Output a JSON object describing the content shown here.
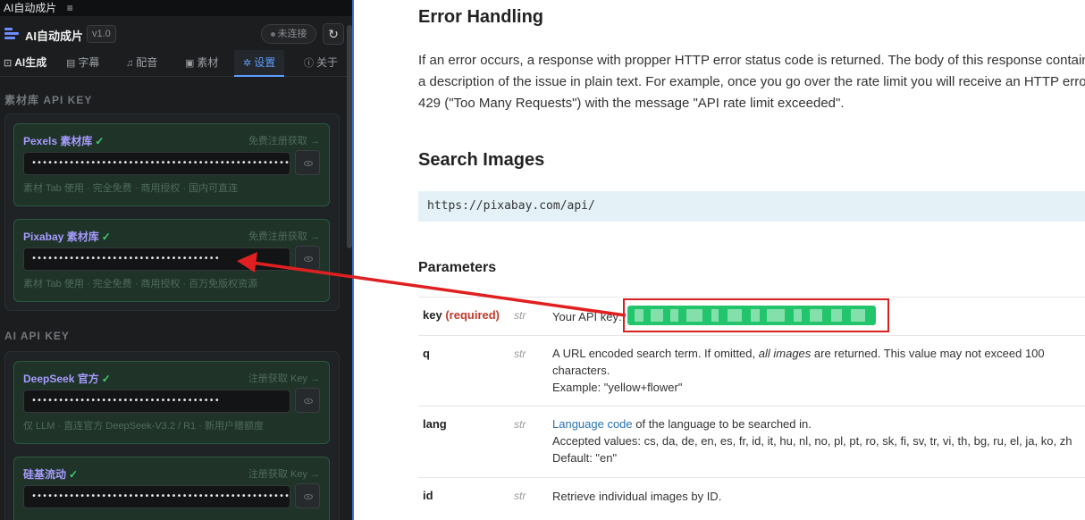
{
  "window": {
    "title": "AI自动成片",
    "menu_glyph": "≡"
  },
  "header": {
    "app_name": "AI自动成片",
    "version": "v1.0",
    "connection_status": "未连接",
    "refresh_glyph": "↻"
  },
  "tabs": [
    {
      "icon": "⊡",
      "label": "AI生成"
    },
    {
      "icon": "▤",
      "label": "字幕"
    },
    {
      "icon": "♫",
      "label": "配音"
    },
    {
      "icon": "▣",
      "label": "素材"
    },
    {
      "icon": "✲",
      "label": "设置"
    },
    {
      "icon": "ⓘ",
      "label": "关于"
    }
  ],
  "sections": {
    "material": {
      "title": "素材库 API KEY",
      "cards": [
        {
          "title": "Pexels 素材库",
          "check": "✓",
          "link": "免费注册获取 →",
          "value": "••••••••••••••••••••••••••••••••••••••••••••••••",
          "desc": "素材 Tab 使用 · 完全免费 · 商用授权 · 国内可直连"
        },
        {
          "title": "Pixabay 素材库",
          "check": "✓",
          "link": "免费注册获取 →",
          "value": "•••••••••••••••••••••••••••••••••••",
          "desc": "素材 Tab 使用 · 完全免费 · 商用授权 · 百万免版权资源"
        }
      ]
    },
    "ai": {
      "title": "AI API KEY",
      "cards": [
        {
          "title": "DeepSeek 官方",
          "check": "✓",
          "link": "注册获取 Key →",
          "value": "•••••••••••••••••••••••••••••••••••",
          "desc": "仅 LLM · 直连官方 DeepSeek-V3.2 / R1 · 新用户赠额度"
        },
        {
          "title": "硅基流动",
          "check": "✓",
          "link": "注册获取 Key →",
          "value": "••••••••••••••••••••••••••••••••••••••••••••••••",
          "desc": ""
        }
      ]
    }
  },
  "doc": {
    "error_heading": "Error Handling",
    "error_text": "If an error occurs, a response with propper HTTP error status code is returned. The body of this response contains a description of the issue in plain text. For example, once you go over the rate limit you will receive an HTTP error 429 (\"Too Many Requests\") with the message \"API rate limit exceeded\".",
    "search_heading": "Search Images",
    "endpoint": "https://pixabay.com/api/",
    "params_heading": "Parameters",
    "params": [
      {
        "name": "key",
        "required": "(required)",
        "type": "str",
        "lines": [
          "Your API key:"
        ]
      },
      {
        "name": "q",
        "type": "str",
        "line1_pre": "A URL encoded search term. If omitted, ",
        "line1_em": "all images",
        "line1_post": " are returned. This value may not exceed 100",
        "line2": "characters.",
        "line3": "Example: \"yellow+flower\""
      },
      {
        "name": "lang",
        "type": "str",
        "link": "Language code",
        "line1_post": " of the language to be searched in.",
        "line2": "Accepted values: cs, da, de, en, es, fr, id, it, hu, nl, no, pl, pt, ro, sk, fi, sv, tr, vi, th, bg, ru, el, ja, ko, zh",
        "line3": "Default: \"en\""
      },
      {
        "name": "id",
        "type": "str",
        "line1": "Retrieve individual images by ID."
      }
    ]
  },
  "colors": {
    "accent": "#5c9dff",
    "card_border": "#2b5840",
    "check": "#3ecf72",
    "title_purple": "#a79bff",
    "arrow": "#e02020",
    "key_highlight": "#22c46c"
  }
}
